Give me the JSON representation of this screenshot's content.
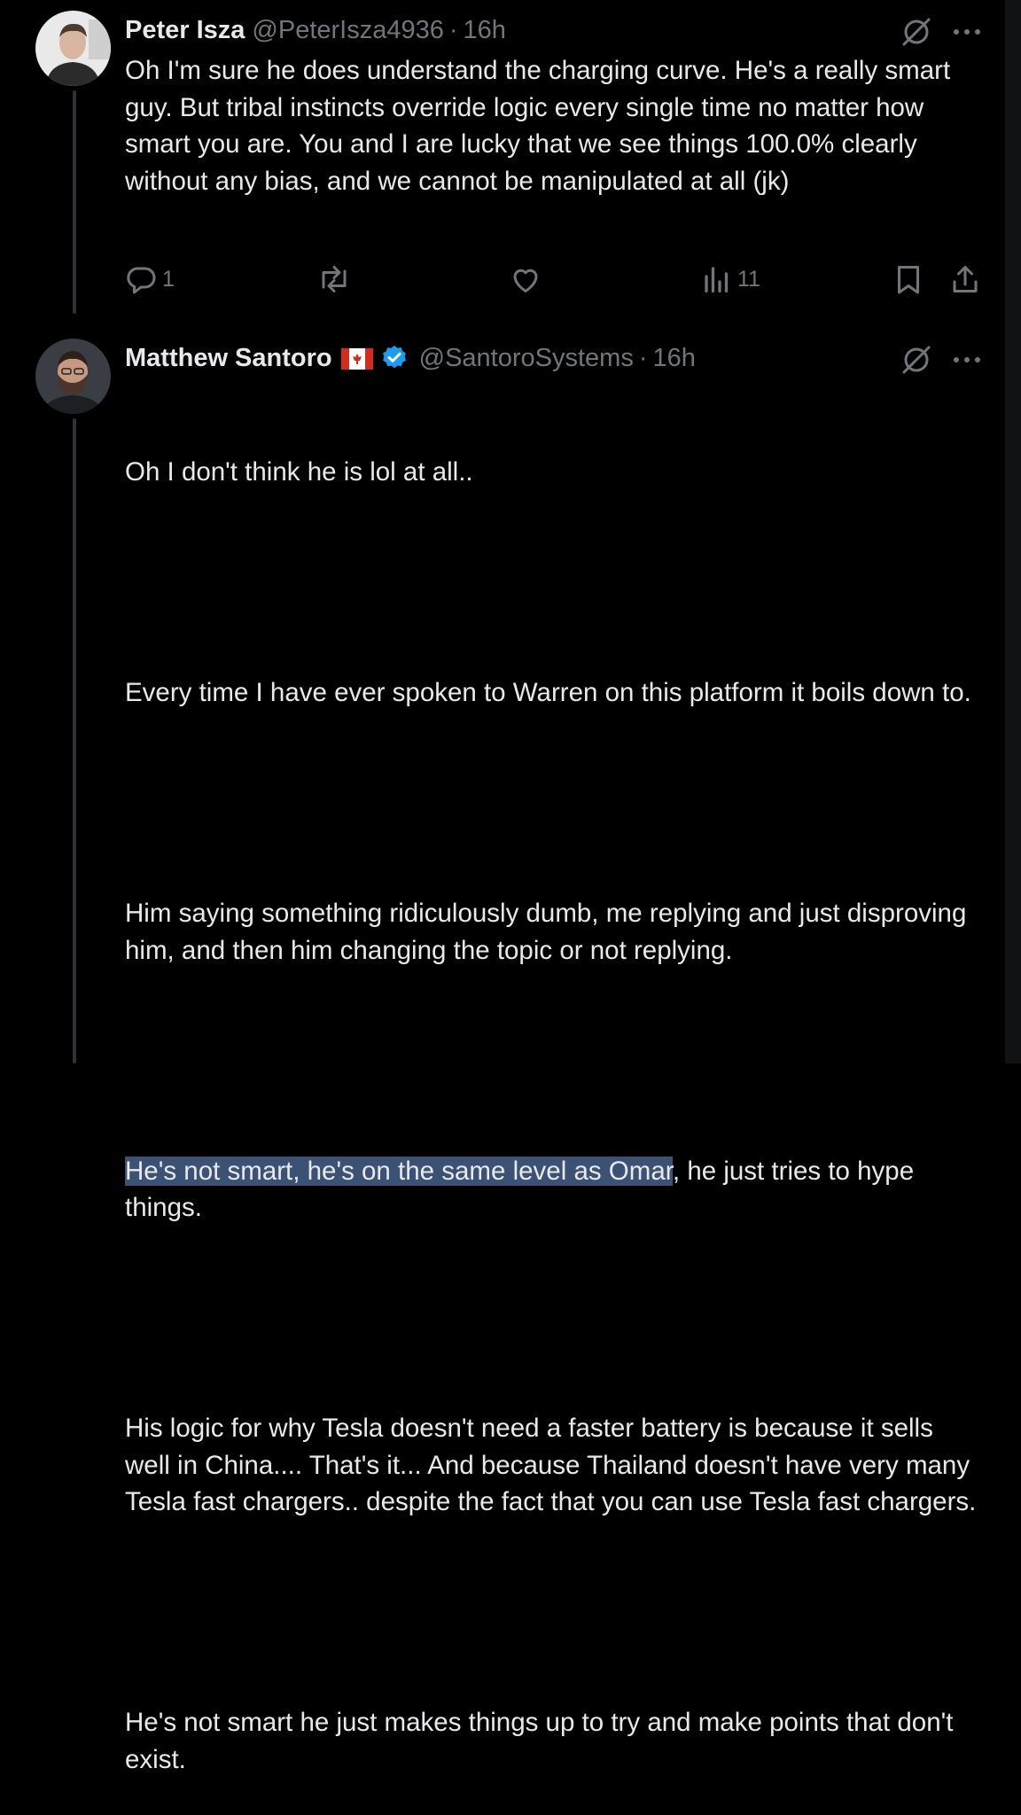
{
  "tweet1": {
    "name": "Peter Isza",
    "handle": "@PeterIsza4936",
    "separator": "·",
    "time": "16h",
    "text": "Oh I'm sure he does understand the charging curve. He's a really smart guy. But tribal instincts override logic every single time no matter how smart you are. You and I are lucky that we see things 100.0% clearly without any bias, and we cannot be manipulated at all (jk)",
    "actions": {
      "replies": "1",
      "views": "11"
    },
    "icons": [
      "grok-icon",
      "more-icon",
      "reply-icon",
      "retweet-icon",
      "like-icon",
      "views-icon",
      "bookmark-icon",
      "share-icon"
    ]
  },
  "tweet2": {
    "name": "Matthew Santoro",
    "handle": "@SantoroSystems",
    "separator": "·",
    "time": "16h",
    "badges": [
      "canada-flag-icon",
      "verified-badge-icon"
    ],
    "p1": "Oh I don't think he is lol at all..",
    "p2": "Every time I have ever spoken to Warren on this platform it boils down to.",
    "p3": "Him saying something ridiculously dumb, me replying and just disproving him, and then him changing the topic or not replying.",
    "p4_highlighted": "He's not smart, he's on the same level as Omar",
    "p4_rest": ", he just tries to hype things.",
    "p5": "His logic for why Tesla doesn't need a faster battery is because it sells well in China.... That's it... And because Thailand doesn't have very many Tesla fast chargers.. despite the fact that you can use Tesla fast chargers.",
    "p6": "He's not smart he just makes things up to try and make points that don't exist."
  },
  "colors": {
    "background": "#000000",
    "text": "#e7e9ea",
    "secondary": "#71767b",
    "verified": "#1d9bf0",
    "selection": "#3b5275"
  }
}
